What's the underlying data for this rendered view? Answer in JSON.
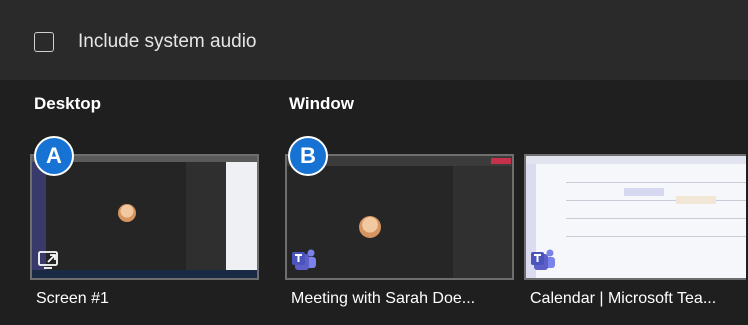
{
  "audio": {
    "checkbox_label": "Include system audio",
    "checked": false
  },
  "desktop": {
    "section_title": "Desktop",
    "items": [
      {
        "badge": "A",
        "label": "Screen #1",
        "icon": "screen-share-icon"
      }
    ]
  },
  "window": {
    "section_title": "Window",
    "items": [
      {
        "badge": "B",
        "label": "Meeting with Sarah Doe...",
        "icon": "teams-icon"
      },
      {
        "label": "Calendar | Microsoft Tea...",
        "icon": "teams-icon"
      }
    ]
  },
  "colors": {
    "background": "#1f1f1f",
    "audio_row": "#2a2a2a",
    "badge": "#1673d4",
    "teams_purple": "#5b5fc7"
  }
}
